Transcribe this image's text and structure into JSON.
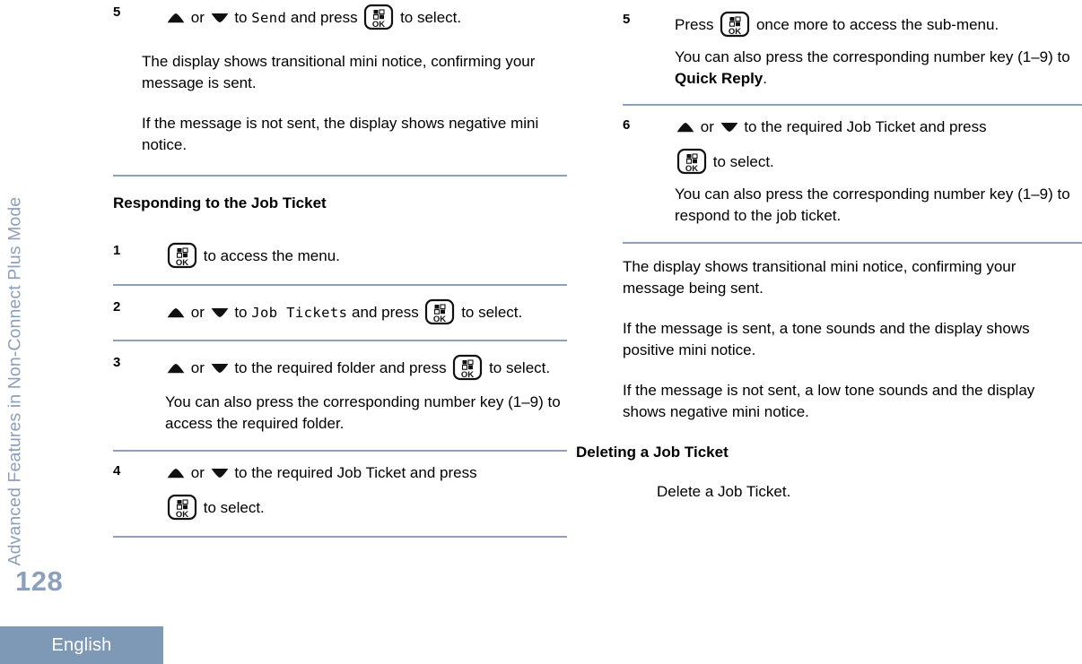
{
  "sidebar": {
    "chapter_title": "Advanced Features in Non-Connect Plus Mode",
    "page_number": "128",
    "language": "English",
    "accent_color": "#8ca0bb",
    "badge_color": "#7e99b5"
  },
  "icons": {
    "up_arrow": "up-arrow-icon",
    "down_arrow": "down-arrow-icon",
    "ok_button": "ok-menu-button-icon"
  },
  "left_column": {
    "step5": {
      "number": "5",
      "line_a": "or",
      "line_b": "to",
      "device_text": "Send",
      "line_c": "and press",
      "line_d": "to select.",
      "note1": "The display shows transitional mini notice, confirming your message is sent.",
      "note2": "If the message is not sent, the display shows negative mini notice."
    },
    "heading": "Responding to the Job Ticket",
    "step1": {
      "number": "1",
      "text": "to access the menu."
    },
    "step2": {
      "number": "2",
      "line_a": "or",
      "line_b": "to",
      "device_text": "Job Tickets",
      "line_c": "and press",
      "line_d": "to select."
    },
    "step3": {
      "number": "3",
      "line_a": "or",
      "line_b": "to the required folder and press",
      "line_c": "to select.",
      "note": "You can also press the corresponding number key (1–9) to access the required folder."
    },
    "step4": {
      "number": "4",
      "line_a": "or",
      "line_b": "to the required Job Ticket and press",
      "line_c": "to select."
    }
  },
  "right_column": {
    "step5": {
      "number": "5",
      "line_a": "Press",
      "line_b": "once more to access the sub-menu.",
      "note_a": "You can also press the corresponding number key (1–9) to",
      "note_bold": "Quick Reply",
      "note_b": "."
    },
    "step6": {
      "number": "6",
      "line_a": "or",
      "line_b": "to the required Job Ticket and press",
      "line_c": "to select.",
      "note": "You can also press the corresponding number key (1–9) to respond to the job ticket."
    },
    "note1": "The display shows transitional mini notice, confirming your message being sent.",
    "note2": "If the message is sent, a tone sounds and the display shows positive mini notice.",
    "note3": "If the message is not sent, a low tone sounds and the display shows negative mini notice.",
    "heading": "Deleting a Job Ticket",
    "body": "Delete a Job Ticket."
  }
}
